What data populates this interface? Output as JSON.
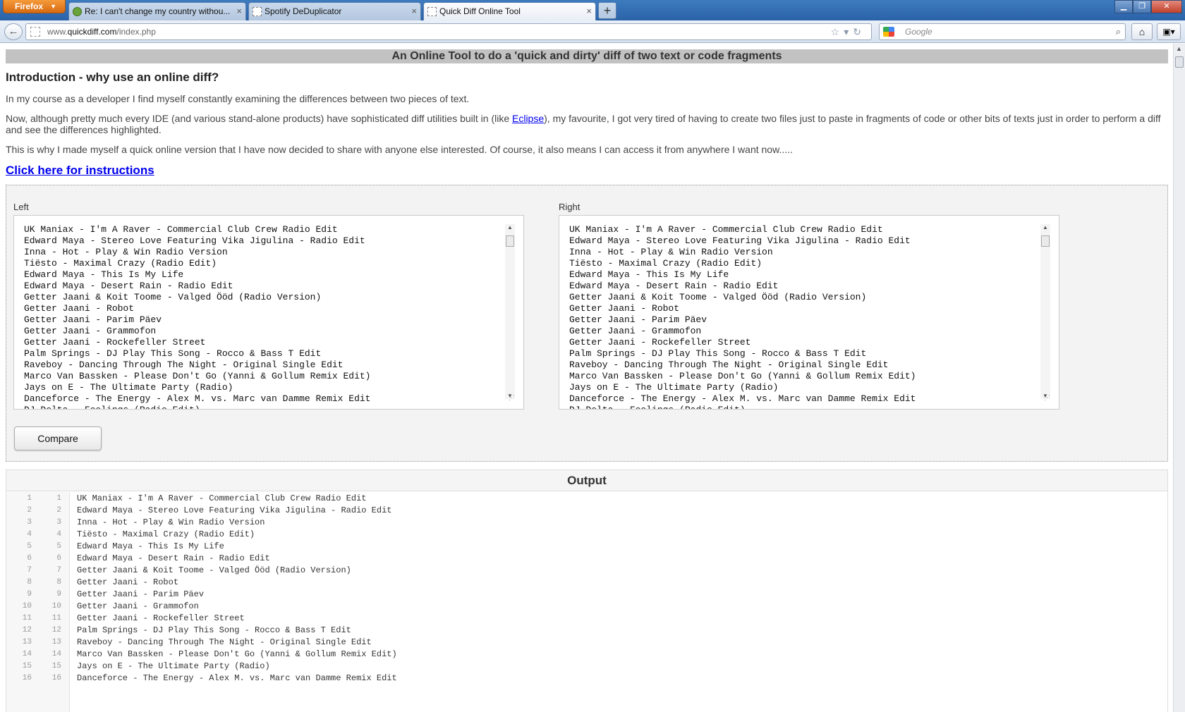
{
  "browser": {
    "menu_label": "Firefox",
    "tabs": [
      {
        "label": "Re: I can't change my country withou..."
      },
      {
        "label": "Spotify DeDuplicator"
      },
      {
        "label": "Quick Diff Online Tool"
      }
    ],
    "url_prefix": "www.",
    "url_domain": "quickdiff.com",
    "url_path": "/index.php",
    "search_placeholder": "Google"
  },
  "page": {
    "header": "An Online Tool to do a 'quick and dirty' diff of two text or code fragments",
    "intro_heading": "Introduction - why use an online diff?",
    "para1": "In my course as a developer I find myself constantly examining the differences between two pieces of text.",
    "para2_before": "Now, although pretty much every IDE (and various stand-alone products) have sophisticated diff utilities built in (like ",
    "para2_link": "Eclipse",
    "para2_after": "), my favourite, I got very tired of having to create two files just to paste in fragments of code or other bits of texts just in order to perform a diff and see the differences highlighted.",
    "para3": "This is why I made myself a quick online version that I have now decided to share with anyone else interested. Of course, it also means I can access it from anywhere I want now.....",
    "instructions_link": "Click here for instructions",
    "left_label": "Left",
    "right_label": "Right",
    "compare_button": "Compare",
    "output_heading": "Output"
  },
  "tracks": [
    "UK Maniax - I'm A Raver - Commercial Club Crew Radio Edit",
    "Edward Maya - Stereo Love Featuring Vika Jigulina - Radio Edit",
    "Inna - Hot - Play & Win Radio Version",
    "Tiësto - Maximal Crazy (Radio Edit)",
    "Edward Maya - This Is My Life",
    "Edward Maya - Desert Rain - Radio Edit",
    "Getter Jaani & Koit Toome - Valged Ööd (Radio Version)",
    "Getter Jaani - Robot",
    "Getter Jaani - Parim Päev",
    "Getter Jaani - Grammofon",
    "Getter Jaani - Rockefeller Street",
    "Palm Springs - DJ Play This Song - Rocco & Bass T Edit",
    "Raveboy - Dancing Through The Night - Original Single Edit",
    "Marco Van Bassken - Please Don't Go (Yanni & Gollum Remix Edit)",
    "Jays on E - The Ultimate Party (Radio)",
    "Danceforce - The Energy - Alex M. vs. Marc van Damme Remix Edit",
    "DJ Delta - Feelings (Radio Edit)"
  ],
  "output_rows": [
    {
      "left": "1",
      "right": "1",
      "text": "UK Maniax - I'm A Raver - Commercial Club Crew Radio Edit"
    },
    {
      "left": "2",
      "right": "2",
      "text": "Edward Maya - Stereo Love Featuring Vika Jigulina - Radio Edit"
    },
    {
      "left": "3",
      "right": "3",
      "text": "Inna - Hot - Play & Win Radio Version"
    },
    {
      "left": "4",
      "right": "4",
      "text": "Tiësto - Maximal Crazy (Radio Edit)"
    },
    {
      "left": "5",
      "right": "5",
      "text": "Edward Maya - This Is My Life"
    },
    {
      "left": "6",
      "right": "6",
      "text": "Edward Maya - Desert Rain - Radio Edit"
    },
    {
      "left": "7",
      "right": "7",
      "text": "Getter Jaani & Koit Toome - Valged Ööd (Radio Version)"
    },
    {
      "left": "8",
      "right": "8",
      "text": "Getter Jaani - Robot"
    },
    {
      "left": "9",
      "right": "9",
      "text": "Getter Jaani - Parim Päev"
    },
    {
      "left": "10",
      "right": "10",
      "text": "Getter Jaani - Grammofon"
    },
    {
      "left": "11",
      "right": "11",
      "text": "Getter Jaani - Rockefeller Street"
    },
    {
      "left": "12",
      "right": "12",
      "text": "Palm Springs - DJ Play This Song - Rocco & Bass T Edit"
    },
    {
      "left": "13",
      "right": "13",
      "text": "Raveboy - Dancing Through The Night - Original Single Edit"
    },
    {
      "left": "14",
      "right": "14",
      "text": "Marco Van Bassken - Please Don't Go (Yanni & Gollum Remix Edit)"
    },
    {
      "left": "15",
      "right": "15",
      "text": "Jays on E - The Ultimate Party (Radio)"
    },
    {
      "left": "16",
      "right": "16",
      "text": "Danceforce - The Energy - Alex M. vs. Marc van Damme Remix Edit"
    }
  ]
}
